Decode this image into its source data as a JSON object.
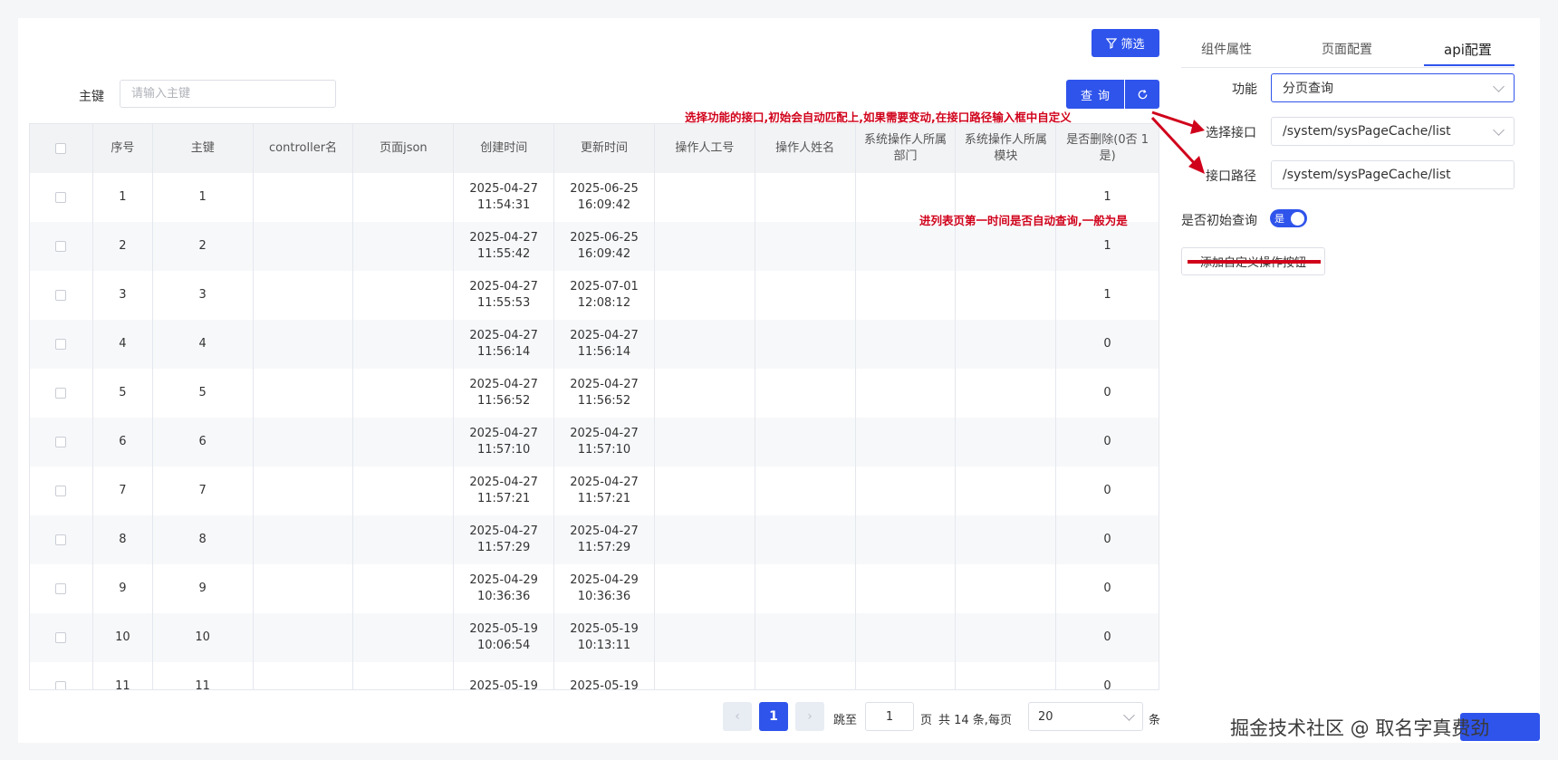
{
  "toolbar": {
    "filter_label": "筛选",
    "query_label": "查询",
    "reset_icon": "refresh-icon"
  },
  "search": {
    "label": "主键",
    "placeholder": "请输入主键"
  },
  "table": {
    "headers": [
      "序号",
      "主键",
      "controller名",
      "页面json",
      "创建时间",
      "更新时间",
      "操作人工号",
      "操作人姓名",
      "系统操作人所属部门",
      "系统操作人所属模块",
      "是否删除(0否 1是)"
    ],
    "rows": [
      {
        "seq": "1",
        "pk": "1",
        "controller": "",
        "json": "",
        "created": "2025-04-27 11:54:31",
        "updated": "2025-06-25 16:09:42",
        "op_id": "",
        "op_name": "",
        "dept": "",
        "module": "",
        "deleted": "1"
      },
      {
        "seq": "2",
        "pk": "2",
        "controller": "",
        "json": "",
        "created": "2025-04-27 11:55:42",
        "updated": "2025-06-25 16:09:42",
        "op_id": "",
        "op_name": "",
        "dept": "",
        "module": "",
        "deleted": "1"
      },
      {
        "seq": "3",
        "pk": "3",
        "controller": "",
        "json": "",
        "created": "2025-04-27 11:55:53",
        "updated": "2025-07-01 12:08:12",
        "op_id": "",
        "op_name": "",
        "dept": "",
        "module": "",
        "deleted": "1"
      },
      {
        "seq": "4",
        "pk": "4",
        "controller": "",
        "json": "",
        "created": "2025-04-27 11:56:14",
        "updated": "2025-04-27 11:56:14",
        "op_id": "",
        "op_name": "",
        "dept": "",
        "module": "",
        "deleted": "0"
      },
      {
        "seq": "5",
        "pk": "5",
        "controller": "",
        "json": "",
        "created": "2025-04-27 11:56:52",
        "updated": "2025-04-27 11:56:52",
        "op_id": "",
        "op_name": "",
        "dept": "",
        "module": "",
        "deleted": "0"
      },
      {
        "seq": "6",
        "pk": "6",
        "controller": "",
        "json": "",
        "created": "2025-04-27 11:57:10",
        "updated": "2025-04-27 11:57:10",
        "op_id": "",
        "op_name": "",
        "dept": "",
        "module": "",
        "deleted": "0"
      },
      {
        "seq": "7",
        "pk": "7",
        "controller": "",
        "json": "",
        "created": "2025-04-27 11:57:21",
        "updated": "2025-04-27 11:57:21",
        "op_id": "",
        "op_name": "",
        "dept": "",
        "module": "",
        "deleted": "0"
      },
      {
        "seq": "8",
        "pk": "8",
        "controller": "",
        "json": "",
        "created": "2025-04-27 11:57:29",
        "updated": "2025-04-27 11:57:29",
        "op_id": "",
        "op_name": "",
        "dept": "",
        "module": "",
        "deleted": "0"
      },
      {
        "seq": "9",
        "pk": "9",
        "controller": "",
        "json": "",
        "created": "2025-04-29 10:36:36",
        "updated": "2025-04-29 10:36:36",
        "op_id": "",
        "op_name": "",
        "dept": "",
        "module": "",
        "deleted": "0"
      },
      {
        "seq": "10",
        "pk": "10",
        "controller": "",
        "json": "",
        "created": "2025-05-19 10:06:54",
        "updated": "2025-05-19 10:13:11",
        "op_id": "",
        "op_name": "",
        "dept": "",
        "module": "",
        "deleted": "0"
      },
      {
        "seq": "11",
        "pk": "11",
        "controller": "",
        "json": "",
        "created": "2025-05-19",
        "updated": "2025-05-19",
        "op_id": "",
        "op_name": "",
        "dept": "",
        "module": "",
        "deleted": "0"
      }
    ]
  },
  "pagination": {
    "current_page": "1",
    "jump_label": "跳至",
    "jump_value": "1",
    "page_label": "页",
    "total_text": "共 14 条,每页",
    "page_size": "20",
    "unit_label": "条"
  },
  "panel": {
    "tabs": [
      "组件属性",
      "页面配置",
      "api配置"
    ],
    "active_tab": "api配置",
    "function_label": "功能",
    "function_value": "分页查询",
    "interface_label": "选择接口",
    "interface_value": "/system/sysPageCache/list",
    "path_label": "接口路径",
    "path_value": "/system/sysPageCache/list",
    "init_query_label": "是否初始查询",
    "init_query_switch_text": "是",
    "add_button_label": "添加自定义操作按钮"
  },
  "annotations": {
    "note1": "选择功能的接口,初始会自动匹配上,如果需要变动,在接口路径输入框中自定义",
    "note2": "进列表页第一时间是否自动查询,一般为是"
  },
  "watermark": "掘金技术社区 @ 取名字真费劲",
  "colors": {
    "primary": "#2f54eb",
    "annotation": "#d0021b"
  }
}
